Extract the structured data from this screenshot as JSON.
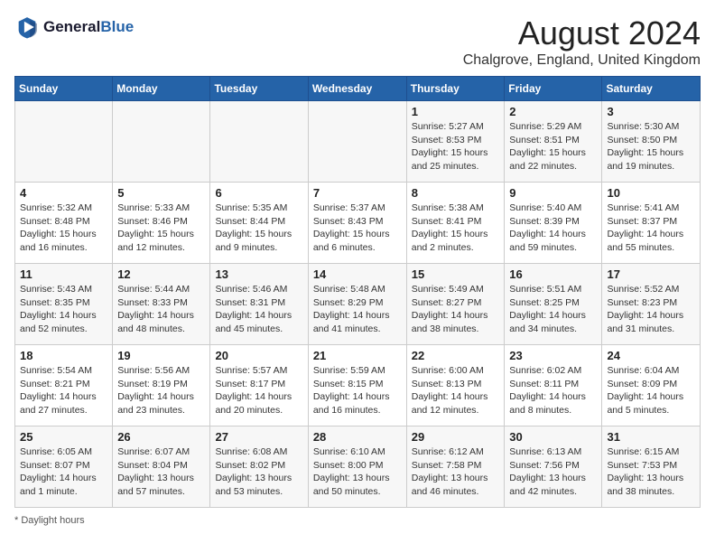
{
  "header": {
    "logo_line1": "General",
    "logo_line2": "Blue",
    "month_year": "August 2024",
    "location": "Chalgrove, England, United Kingdom"
  },
  "days_of_week": [
    "Sunday",
    "Monday",
    "Tuesday",
    "Wednesday",
    "Thursday",
    "Friday",
    "Saturday"
  ],
  "footer": {
    "note": "Daylight hours"
  },
  "weeks": [
    [
      {
        "day": "",
        "info": ""
      },
      {
        "day": "",
        "info": ""
      },
      {
        "day": "",
        "info": ""
      },
      {
        "day": "",
        "info": ""
      },
      {
        "day": "1",
        "info": "Sunrise: 5:27 AM\nSunset: 8:53 PM\nDaylight: 15 hours\nand 25 minutes."
      },
      {
        "day": "2",
        "info": "Sunrise: 5:29 AM\nSunset: 8:51 PM\nDaylight: 15 hours\nand 22 minutes."
      },
      {
        "day": "3",
        "info": "Sunrise: 5:30 AM\nSunset: 8:50 PM\nDaylight: 15 hours\nand 19 minutes."
      }
    ],
    [
      {
        "day": "4",
        "info": "Sunrise: 5:32 AM\nSunset: 8:48 PM\nDaylight: 15 hours\nand 16 minutes."
      },
      {
        "day": "5",
        "info": "Sunrise: 5:33 AM\nSunset: 8:46 PM\nDaylight: 15 hours\nand 12 minutes."
      },
      {
        "day": "6",
        "info": "Sunrise: 5:35 AM\nSunset: 8:44 PM\nDaylight: 15 hours\nand 9 minutes."
      },
      {
        "day": "7",
        "info": "Sunrise: 5:37 AM\nSunset: 8:43 PM\nDaylight: 15 hours\nand 6 minutes."
      },
      {
        "day": "8",
        "info": "Sunrise: 5:38 AM\nSunset: 8:41 PM\nDaylight: 15 hours\nand 2 minutes."
      },
      {
        "day": "9",
        "info": "Sunrise: 5:40 AM\nSunset: 8:39 PM\nDaylight: 14 hours\nand 59 minutes."
      },
      {
        "day": "10",
        "info": "Sunrise: 5:41 AM\nSunset: 8:37 PM\nDaylight: 14 hours\nand 55 minutes."
      }
    ],
    [
      {
        "day": "11",
        "info": "Sunrise: 5:43 AM\nSunset: 8:35 PM\nDaylight: 14 hours\nand 52 minutes."
      },
      {
        "day": "12",
        "info": "Sunrise: 5:44 AM\nSunset: 8:33 PM\nDaylight: 14 hours\nand 48 minutes."
      },
      {
        "day": "13",
        "info": "Sunrise: 5:46 AM\nSunset: 8:31 PM\nDaylight: 14 hours\nand 45 minutes."
      },
      {
        "day": "14",
        "info": "Sunrise: 5:48 AM\nSunset: 8:29 PM\nDaylight: 14 hours\nand 41 minutes."
      },
      {
        "day": "15",
        "info": "Sunrise: 5:49 AM\nSunset: 8:27 PM\nDaylight: 14 hours\nand 38 minutes."
      },
      {
        "day": "16",
        "info": "Sunrise: 5:51 AM\nSunset: 8:25 PM\nDaylight: 14 hours\nand 34 minutes."
      },
      {
        "day": "17",
        "info": "Sunrise: 5:52 AM\nSunset: 8:23 PM\nDaylight: 14 hours\nand 31 minutes."
      }
    ],
    [
      {
        "day": "18",
        "info": "Sunrise: 5:54 AM\nSunset: 8:21 PM\nDaylight: 14 hours\nand 27 minutes."
      },
      {
        "day": "19",
        "info": "Sunrise: 5:56 AM\nSunset: 8:19 PM\nDaylight: 14 hours\nand 23 minutes."
      },
      {
        "day": "20",
        "info": "Sunrise: 5:57 AM\nSunset: 8:17 PM\nDaylight: 14 hours\nand 20 minutes."
      },
      {
        "day": "21",
        "info": "Sunrise: 5:59 AM\nSunset: 8:15 PM\nDaylight: 14 hours\nand 16 minutes."
      },
      {
        "day": "22",
        "info": "Sunrise: 6:00 AM\nSunset: 8:13 PM\nDaylight: 14 hours\nand 12 minutes."
      },
      {
        "day": "23",
        "info": "Sunrise: 6:02 AM\nSunset: 8:11 PM\nDaylight: 14 hours\nand 8 minutes."
      },
      {
        "day": "24",
        "info": "Sunrise: 6:04 AM\nSunset: 8:09 PM\nDaylight: 14 hours\nand 5 minutes."
      }
    ],
    [
      {
        "day": "25",
        "info": "Sunrise: 6:05 AM\nSunset: 8:07 PM\nDaylight: 14 hours\nand 1 minute."
      },
      {
        "day": "26",
        "info": "Sunrise: 6:07 AM\nSunset: 8:04 PM\nDaylight: 13 hours\nand 57 minutes."
      },
      {
        "day": "27",
        "info": "Sunrise: 6:08 AM\nSunset: 8:02 PM\nDaylight: 13 hours\nand 53 minutes."
      },
      {
        "day": "28",
        "info": "Sunrise: 6:10 AM\nSunset: 8:00 PM\nDaylight: 13 hours\nand 50 minutes."
      },
      {
        "day": "29",
        "info": "Sunrise: 6:12 AM\nSunset: 7:58 PM\nDaylight: 13 hours\nand 46 minutes."
      },
      {
        "day": "30",
        "info": "Sunrise: 6:13 AM\nSunset: 7:56 PM\nDaylight: 13 hours\nand 42 minutes."
      },
      {
        "day": "31",
        "info": "Sunrise: 6:15 AM\nSunset: 7:53 PM\nDaylight: 13 hours\nand 38 minutes."
      }
    ]
  ]
}
